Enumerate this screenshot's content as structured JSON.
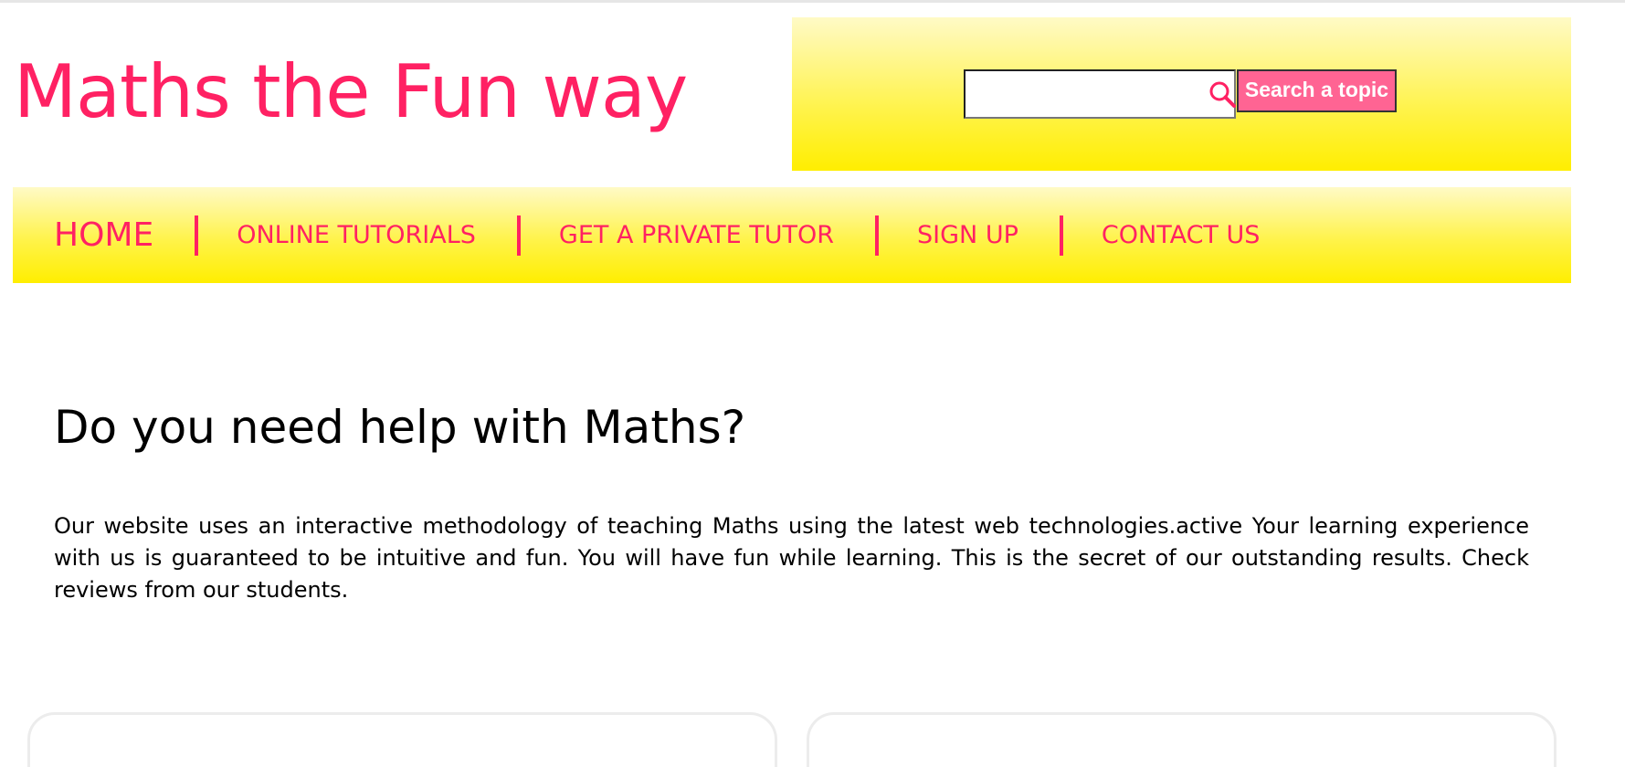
{
  "header": {
    "site_title": "Maths the Fun way"
  },
  "search": {
    "value": "",
    "button_label": "Search a topic",
    "icon": "search-icon"
  },
  "nav": {
    "items": [
      {
        "label": "HOME"
      },
      {
        "label": "ONLINE TUTORIALS"
      },
      {
        "label": "GET A PRIVATE TUTOR"
      },
      {
        "label": "SIGN UP"
      },
      {
        "label": "CONTACT US"
      }
    ]
  },
  "main": {
    "heading": "Do you need help with Maths?",
    "paragraph": "Our website uses an interactive methodology of teaching Maths using the latest web technologies.active Your learning experience with us is guaranteed to be intuitive and fun. You will have fun while learning. This is the secret of our outstanding results. Check reviews from our students."
  },
  "colors": {
    "accent": "#ff2163",
    "button": "#ff6493",
    "band_yellow": "#ffee00"
  }
}
